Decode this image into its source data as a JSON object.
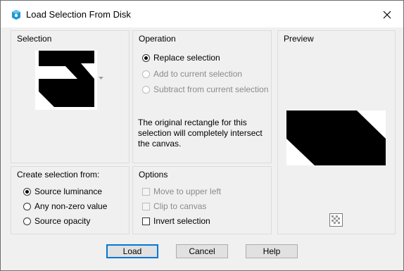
{
  "window": {
    "title": "Load Selection From Disk",
    "icon": "app-icon",
    "close_icon": "close-icon"
  },
  "selection_group": {
    "label": "Selection"
  },
  "operation_group": {
    "label": "Operation",
    "options": [
      {
        "label": "Replace selection",
        "selected": true,
        "enabled": true
      },
      {
        "label": "Add to current selection",
        "selected": false,
        "enabled": false
      },
      {
        "label": "Subtract from current selection",
        "selected": false,
        "enabled": false
      }
    ],
    "note": "The original rectangle for this selection will completely intersect the canvas."
  },
  "preview_group": {
    "label": "Preview",
    "checker_icon": "transparency-checker-icon"
  },
  "create_from_group": {
    "label": "Create selection from:",
    "options": [
      {
        "label": "Source luminance",
        "selected": true
      },
      {
        "label": "Any non-zero value",
        "selected": false
      },
      {
        "label": "Source opacity",
        "selected": false
      }
    ]
  },
  "options_group": {
    "label": "Options",
    "items": [
      {
        "label": "Move to upper left",
        "checked": false,
        "enabled": false
      },
      {
        "label": "Clip to canvas",
        "checked": false,
        "enabled": false
      },
      {
        "label": "Invert selection",
        "checked": false,
        "enabled": true
      }
    ]
  },
  "buttons": {
    "load": "Load",
    "cancel": "Cancel",
    "help": "Help"
  },
  "colors": {
    "dialog_bg": "#f0f0f0",
    "accent": "#0078d7",
    "disabled_text": "#8b8b8b"
  }
}
